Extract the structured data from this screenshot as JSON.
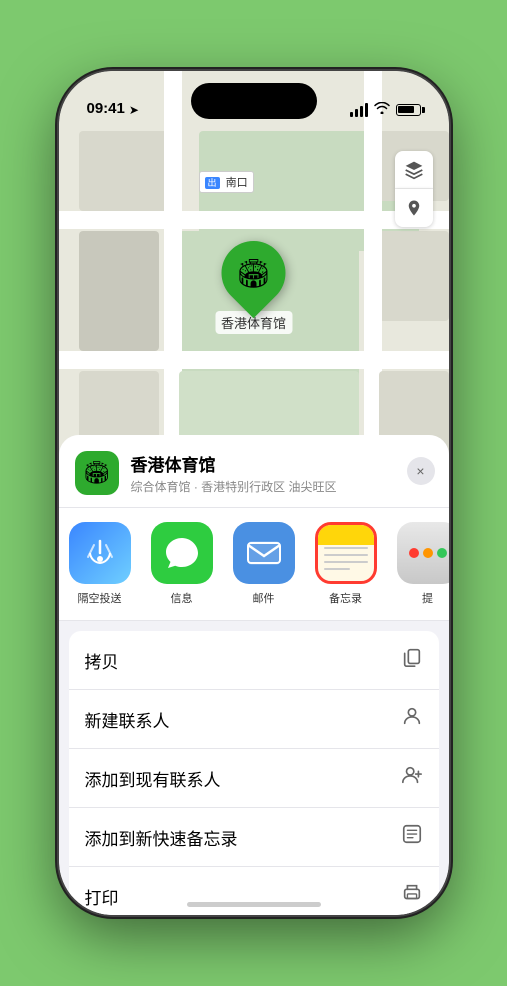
{
  "status_bar": {
    "time": "09:41",
    "location_arrow": "▲"
  },
  "map": {
    "label": "南口",
    "pin_label": "香港体育馆"
  },
  "location_card": {
    "name": "香港体育馆",
    "description": "综合体育馆 · 香港特别行政区 油尖旺区",
    "close_label": "×"
  },
  "share_items": [
    {
      "id": "airdrop",
      "label": "隔空投送",
      "icon_type": "airdrop"
    },
    {
      "id": "messages",
      "label": "信息",
      "icon_type": "messages"
    },
    {
      "id": "mail",
      "label": "邮件",
      "icon_type": "mail"
    },
    {
      "id": "notes",
      "label": "备忘录",
      "icon_type": "notes"
    },
    {
      "id": "more",
      "label": "提",
      "icon_type": "more"
    }
  ],
  "action_items": [
    {
      "id": "copy",
      "label": "拷贝",
      "icon": "⎘"
    },
    {
      "id": "new-contact",
      "label": "新建联系人",
      "icon": "👤"
    },
    {
      "id": "add-existing",
      "label": "添加到现有联系人",
      "icon": "👤"
    },
    {
      "id": "add-notes",
      "label": "添加到新快速备忘录",
      "icon": "⊡"
    },
    {
      "id": "print",
      "label": "打印",
      "icon": "🖨"
    }
  ]
}
